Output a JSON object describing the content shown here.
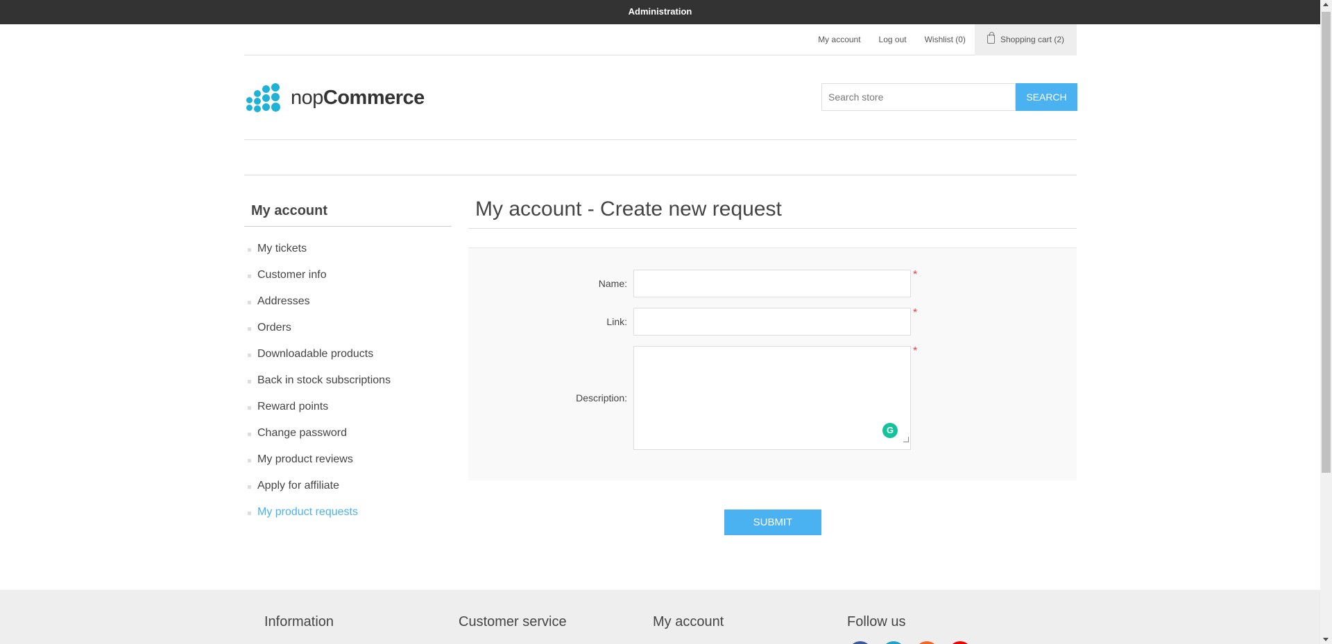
{
  "admin_bar": {
    "label": "Administration"
  },
  "header_links": {
    "my_account": "My account",
    "log_out": "Log out",
    "wishlist": "Wishlist (0)",
    "cart": "Shopping cart (2)"
  },
  "logo": {
    "text_light": "nop",
    "text_bold": "Commerce"
  },
  "search": {
    "placeholder": "Search store",
    "button": "Search"
  },
  "sidebar": {
    "title": "My account",
    "items": [
      {
        "label": "My tickets"
      },
      {
        "label": "Customer info"
      },
      {
        "label": "Addresses"
      },
      {
        "label": "Orders"
      },
      {
        "label": "Downloadable products"
      },
      {
        "label": "Back in stock subscriptions"
      },
      {
        "label": "Reward points"
      },
      {
        "label": "Change password"
      },
      {
        "label": "My product reviews"
      },
      {
        "label": "Apply for affiliate"
      },
      {
        "label": "My product requests"
      }
    ]
  },
  "page": {
    "title": "My account - Create new request"
  },
  "form": {
    "name_label": "Name:",
    "link_label": "Link:",
    "description_label": "Description:",
    "name_value": "",
    "link_value": "",
    "description_value": "",
    "required_marker": "*",
    "submit": "Submit"
  },
  "footer": {
    "col1": "Information",
    "col2": "Customer service",
    "col3": "My account",
    "col4": "Follow us"
  },
  "colors": {
    "accent": "#4ab2f1",
    "admin_bar": "#333333",
    "required": "#e4434b",
    "grammarly": "#15c39a"
  },
  "icons": [
    "cart-icon",
    "grammarly-icon",
    "facebook-icon",
    "twitter-icon",
    "rss-icon",
    "youtube-icon"
  ]
}
